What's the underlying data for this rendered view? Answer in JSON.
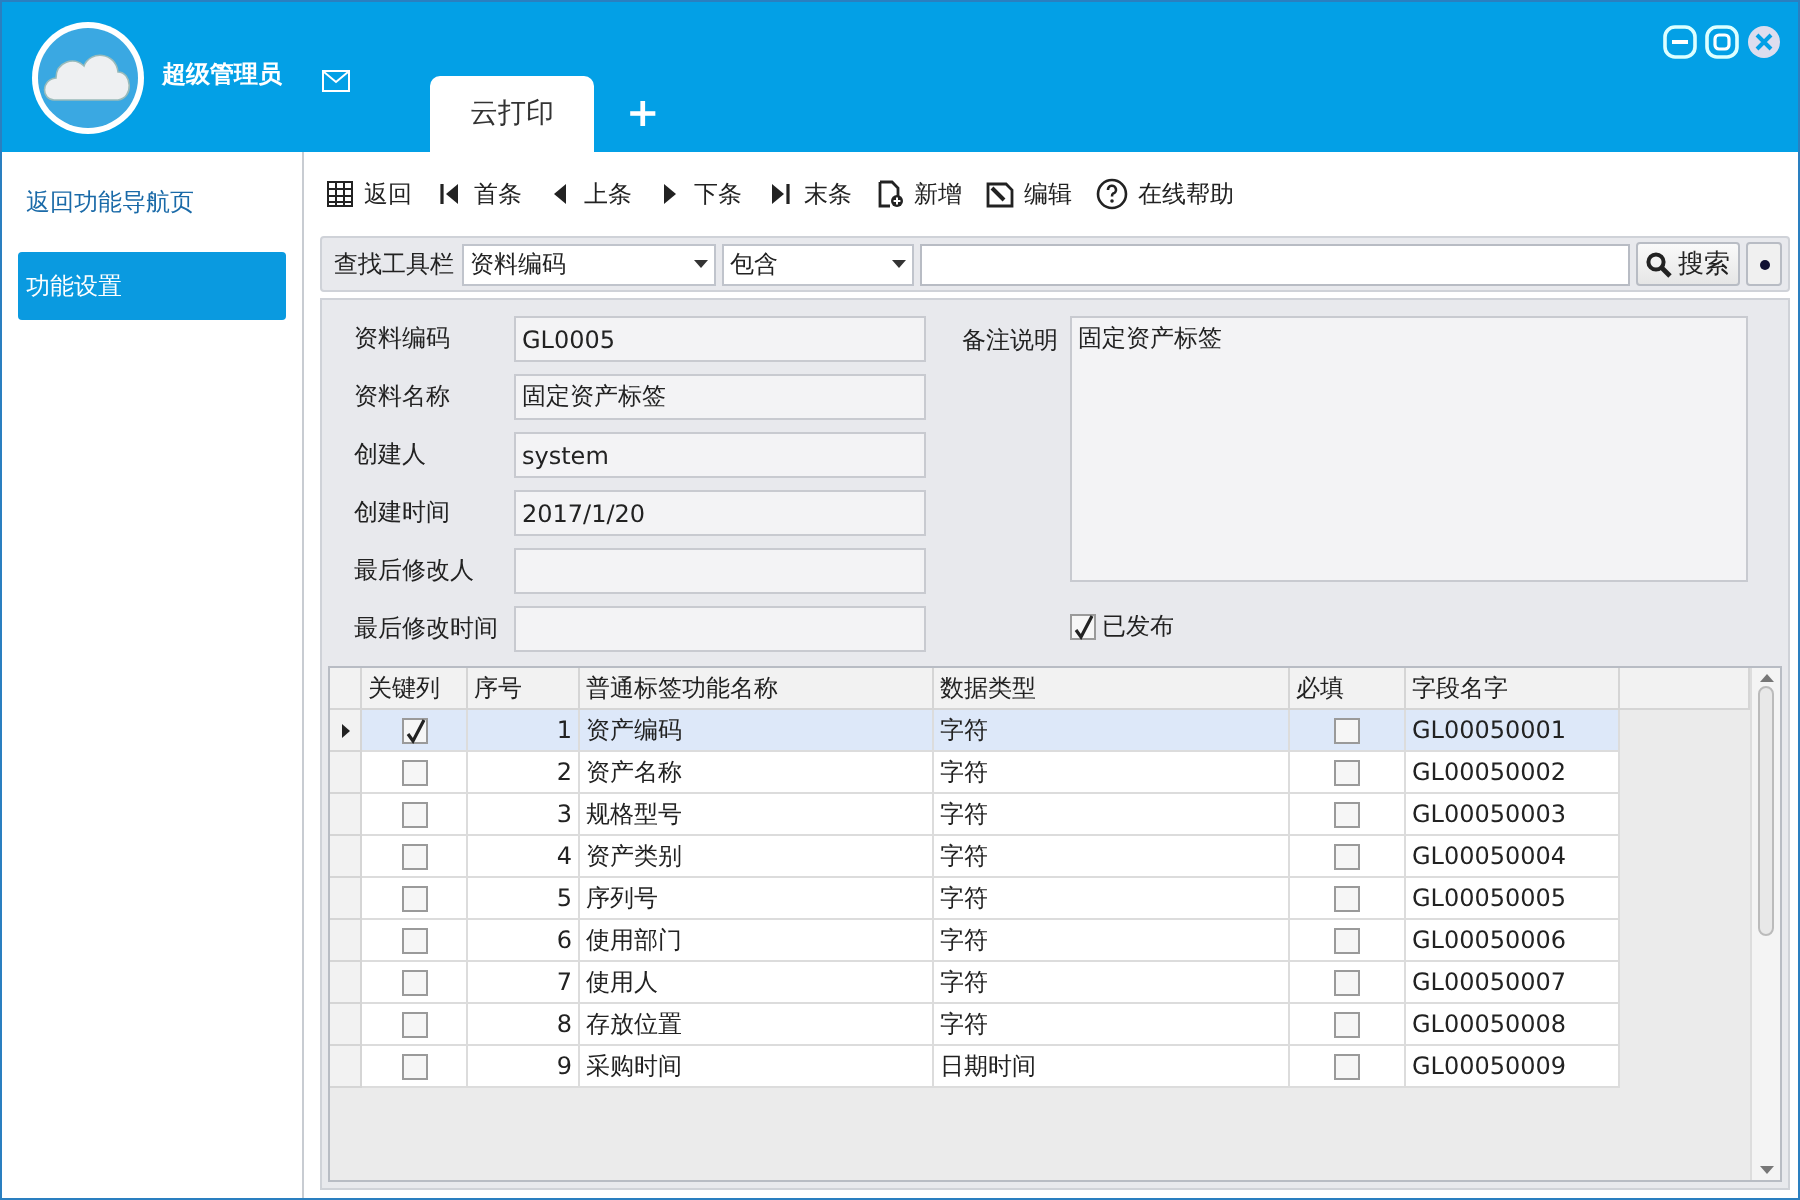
{
  "header": {
    "user": "超级管理员",
    "tabs": [
      {
        "label": "云打印",
        "selected": true
      }
    ],
    "add_tab": "+"
  },
  "sidebar": {
    "items": [
      {
        "label": "返回功能导航页",
        "selected": false
      },
      {
        "label": "功能设置",
        "selected": true
      }
    ]
  },
  "toolbar": [
    {
      "kind": "grid",
      "label": "返回"
    },
    {
      "kind": "first",
      "label": "首条"
    },
    {
      "kind": "prev",
      "label": "上条"
    },
    {
      "kind": "next",
      "label": "下条"
    },
    {
      "kind": "last",
      "label": "末条"
    },
    {
      "kind": "new",
      "label": "新增"
    },
    {
      "kind": "edit",
      "label": "编辑"
    },
    {
      "kind": "help",
      "label": "在线帮助"
    }
  ],
  "search": {
    "label": "查找工具栏",
    "field": "资料编码",
    "operator": "包含",
    "button": "搜索"
  },
  "form": {
    "fields": [
      {
        "label": "资料编码",
        "value": "GL0005"
      },
      {
        "label": "资料名称",
        "value": "固定资产标签"
      },
      {
        "label": "创建人",
        "value": "system"
      },
      {
        "label": "创建时间",
        "value": "2017/1/20"
      },
      {
        "label": "最后修改人"
      },
      {
        "label": "最后修改时间"
      }
    ],
    "remark_label": "备注说明",
    "remark": "固定资产标签",
    "published": {
      "label": "已发布",
      "checked": true
    }
  },
  "table": {
    "columns": [
      "关键列",
      "序号",
      "普通标签功能名称",
      "数据类型",
      "必填",
      "字段名字"
    ],
    "rows": [
      {
        "key": true,
        "no": "1",
        "name": "资产编码",
        "type": "字符",
        "required": false,
        "field": "GL00050001",
        "selected": true
      },
      {
        "key": false,
        "no": "2",
        "name": "资产名称",
        "type": "字符",
        "required": false,
        "field": "GL00050002",
        "selected": false
      },
      {
        "key": false,
        "no": "3",
        "name": "规格型号",
        "type": "字符",
        "required": false,
        "field": "GL00050003",
        "selected": false
      },
      {
        "key": false,
        "no": "4",
        "name": "资产类别",
        "type": "字符",
        "required": false,
        "field": "GL00050004",
        "selected": false
      },
      {
        "key": false,
        "no": "5",
        "name": "序列号",
        "type": "字符",
        "required": false,
        "field": "GL00050005",
        "selected": false
      },
      {
        "key": false,
        "no": "6",
        "name": "使用部门",
        "type": "字符",
        "required": false,
        "field": "GL00050006",
        "selected": false
      },
      {
        "key": false,
        "no": "7",
        "name": "使用人",
        "type": "字符",
        "required": false,
        "field": "GL00050007",
        "selected": false
      },
      {
        "key": false,
        "no": "8",
        "name": "存放位置",
        "type": "字符",
        "required": false,
        "field": "GL00050008",
        "selected": false
      },
      {
        "key": false,
        "no": "9",
        "name": "采购时间",
        "type": "日期时间",
        "required": false,
        "field": "GL00050009",
        "selected": false
      }
    ]
  }
}
